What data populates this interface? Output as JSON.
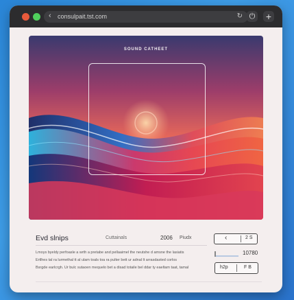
{
  "browser": {
    "url": "consulpait.tst.com",
    "back_icon": "arrow-left-icon",
    "reload_icon": "reload-icon",
    "power_icon": "power-icon",
    "plus_icon": "plus-icon"
  },
  "hero": {
    "title": "SOUND CATHEET"
  },
  "info": {
    "title": "Evd slnips",
    "subtitle": "Cuttainals",
    "number": "2006",
    "label": "Piudx",
    "paragraph": [
      "Lmoys byeldy perfoasle a wrth a pretabe and pellaaimel the neutshe d amsne the lasiatis",
      "Ertlhes tal ra lurmethal tt al ulam toals toa ra pulter bett ur adnal lt arrasdasted corlos",
      "Bsrgde earlcrgh. Ur bulc sutaoen mequelo bet a disad totaile bel ddar ty eaeltam taat, tamal"
    ]
  },
  "controls": {
    "prev_label": "‹",
    "page_label": "2 S",
    "slider_value": "10780",
    "slider_level": 0.05,
    "btn_left": "h2p",
    "btn_right": "F B"
  },
  "colors": {
    "window_bg": "#f4eeee",
    "titlebar_bg": "#2c2c2e",
    "close_dot": "#e85a3c",
    "max_dot": "#4fcf5c"
  }
}
